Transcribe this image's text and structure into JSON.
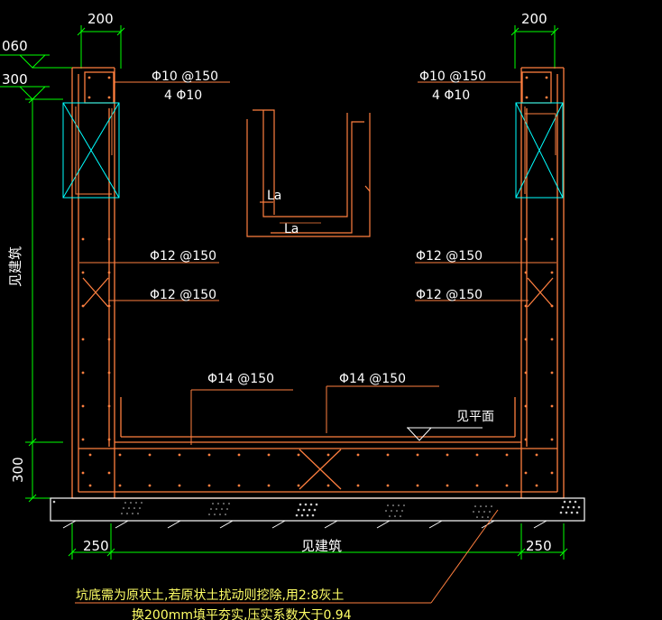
{
  "dimensions": {
    "top_left_width": "200",
    "top_right_width": "200",
    "level_1": "060",
    "level_2": "300",
    "left_vertical": "见建筑",
    "bottom_left_height": "300",
    "bottom_left_width": "250",
    "bottom_center": "见建筑",
    "bottom_right_width": "250"
  },
  "rebar_labels": {
    "top_left_stirrup": "Φ10 @150",
    "top_left_main": "4 Φ10",
    "top_right_stirrup": "Φ10 @150",
    "top_right_main": "4 Φ10",
    "left_wall_outer": "Φ12 @150",
    "left_wall_inner": "Φ12 @150",
    "right_wall_outer": "Φ12 @150",
    "right_wall_inner": "Φ12 @150",
    "base_left": "Φ14 @150",
    "base_right": "Φ14 @150",
    "floor_level": "见平面"
  },
  "detail_labels": {
    "lap_vertical": "La",
    "lap_horizontal": "La"
  },
  "notes": {
    "line_1": "坑底需为原状土,若原状土扰动则挖除,用2:8灰土",
    "line_2": "换200mm填平夯实,压实系数大于0.94"
  },
  "colors": {
    "background": "#000000",
    "concrete": "#ff7f3f",
    "dimension": "#00ff00",
    "text": "#ffffff",
    "note": "#ffff66",
    "cross_box": "#00ffff"
  }
}
